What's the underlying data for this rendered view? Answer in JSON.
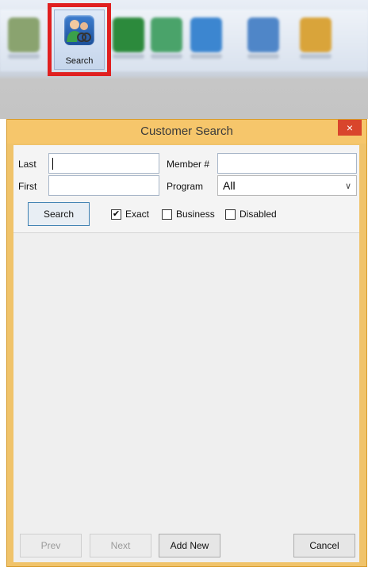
{
  "toolbar": {
    "search_label": "Search",
    "icon_colors": [
      "#6b9e4a",
      "#2c8a3c",
      "#4aa3d8",
      "#3c86d0",
      "#4f86c8",
      "#d9a43a"
    ]
  },
  "dialog": {
    "title": "Customer Search",
    "close_glyph": "×"
  },
  "filters": {
    "last_label": "Last",
    "last_value": "",
    "first_label": "First",
    "first_value": "",
    "member_label": "Member #",
    "member_value": "",
    "program_label": "Program",
    "program_value": "All",
    "search_button": "Search",
    "exact": {
      "label": "Exact",
      "checked": true
    },
    "business": {
      "label": "Business",
      "checked": false
    },
    "disabled": {
      "label": "Disabled",
      "checked": false
    }
  },
  "footer": {
    "prev": "Prev",
    "next": "Next",
    "add_new": "Add New",
    "cancel": "Cancel"
  },
  "colors": {
    "dialog_frame": "#f0c36a",
    "close_button": "#d9452c",
    "highlight": "#e02020"
  }
}
